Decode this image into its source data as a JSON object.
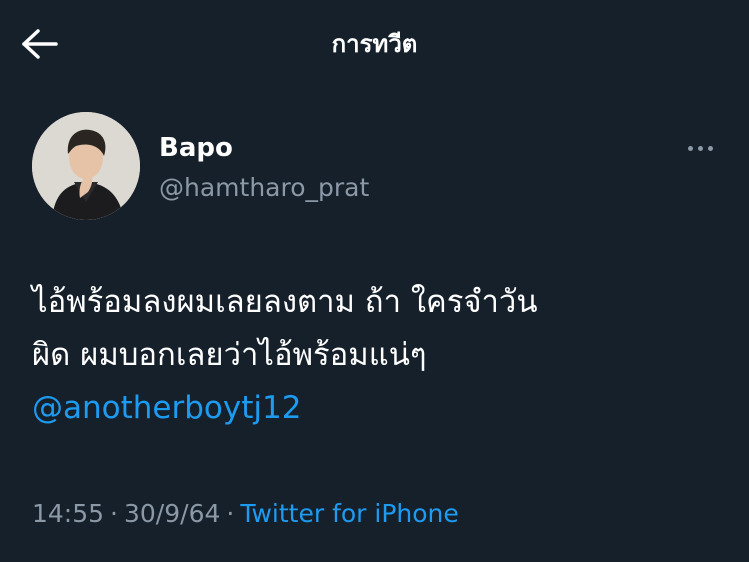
{
  "header": {
    "back_icon": "arrow-left-icon",
    "title": "การทวีต"
  },
  "tweet": {
    "author": {
      "display_name": "Bapo",
      "handle": "@hamtharo_prat"
    },
    "more_icon": "more-horizontal-icon",
    "text_lines": [
      "ไอ้พร้อมลงผมเลยลงตาม ถ้า ใครจำวัน",
      "ผิด ผมบอกเลยว่าไอ้พร้อมแน่ๆ"
    ],
    "mention": "@anotherboytj12",
    "time": "14:55",
    "separator": "·",
    "date": "30/9/64",
    "source": "Twitter for iPhone"
  },
  "colors": {
    "background": "#15202b",
    "text_primary": "#ffffff",
    "text_secondary": "#8b98a5",
    "accent": "#1d9bf0"
  }
}
